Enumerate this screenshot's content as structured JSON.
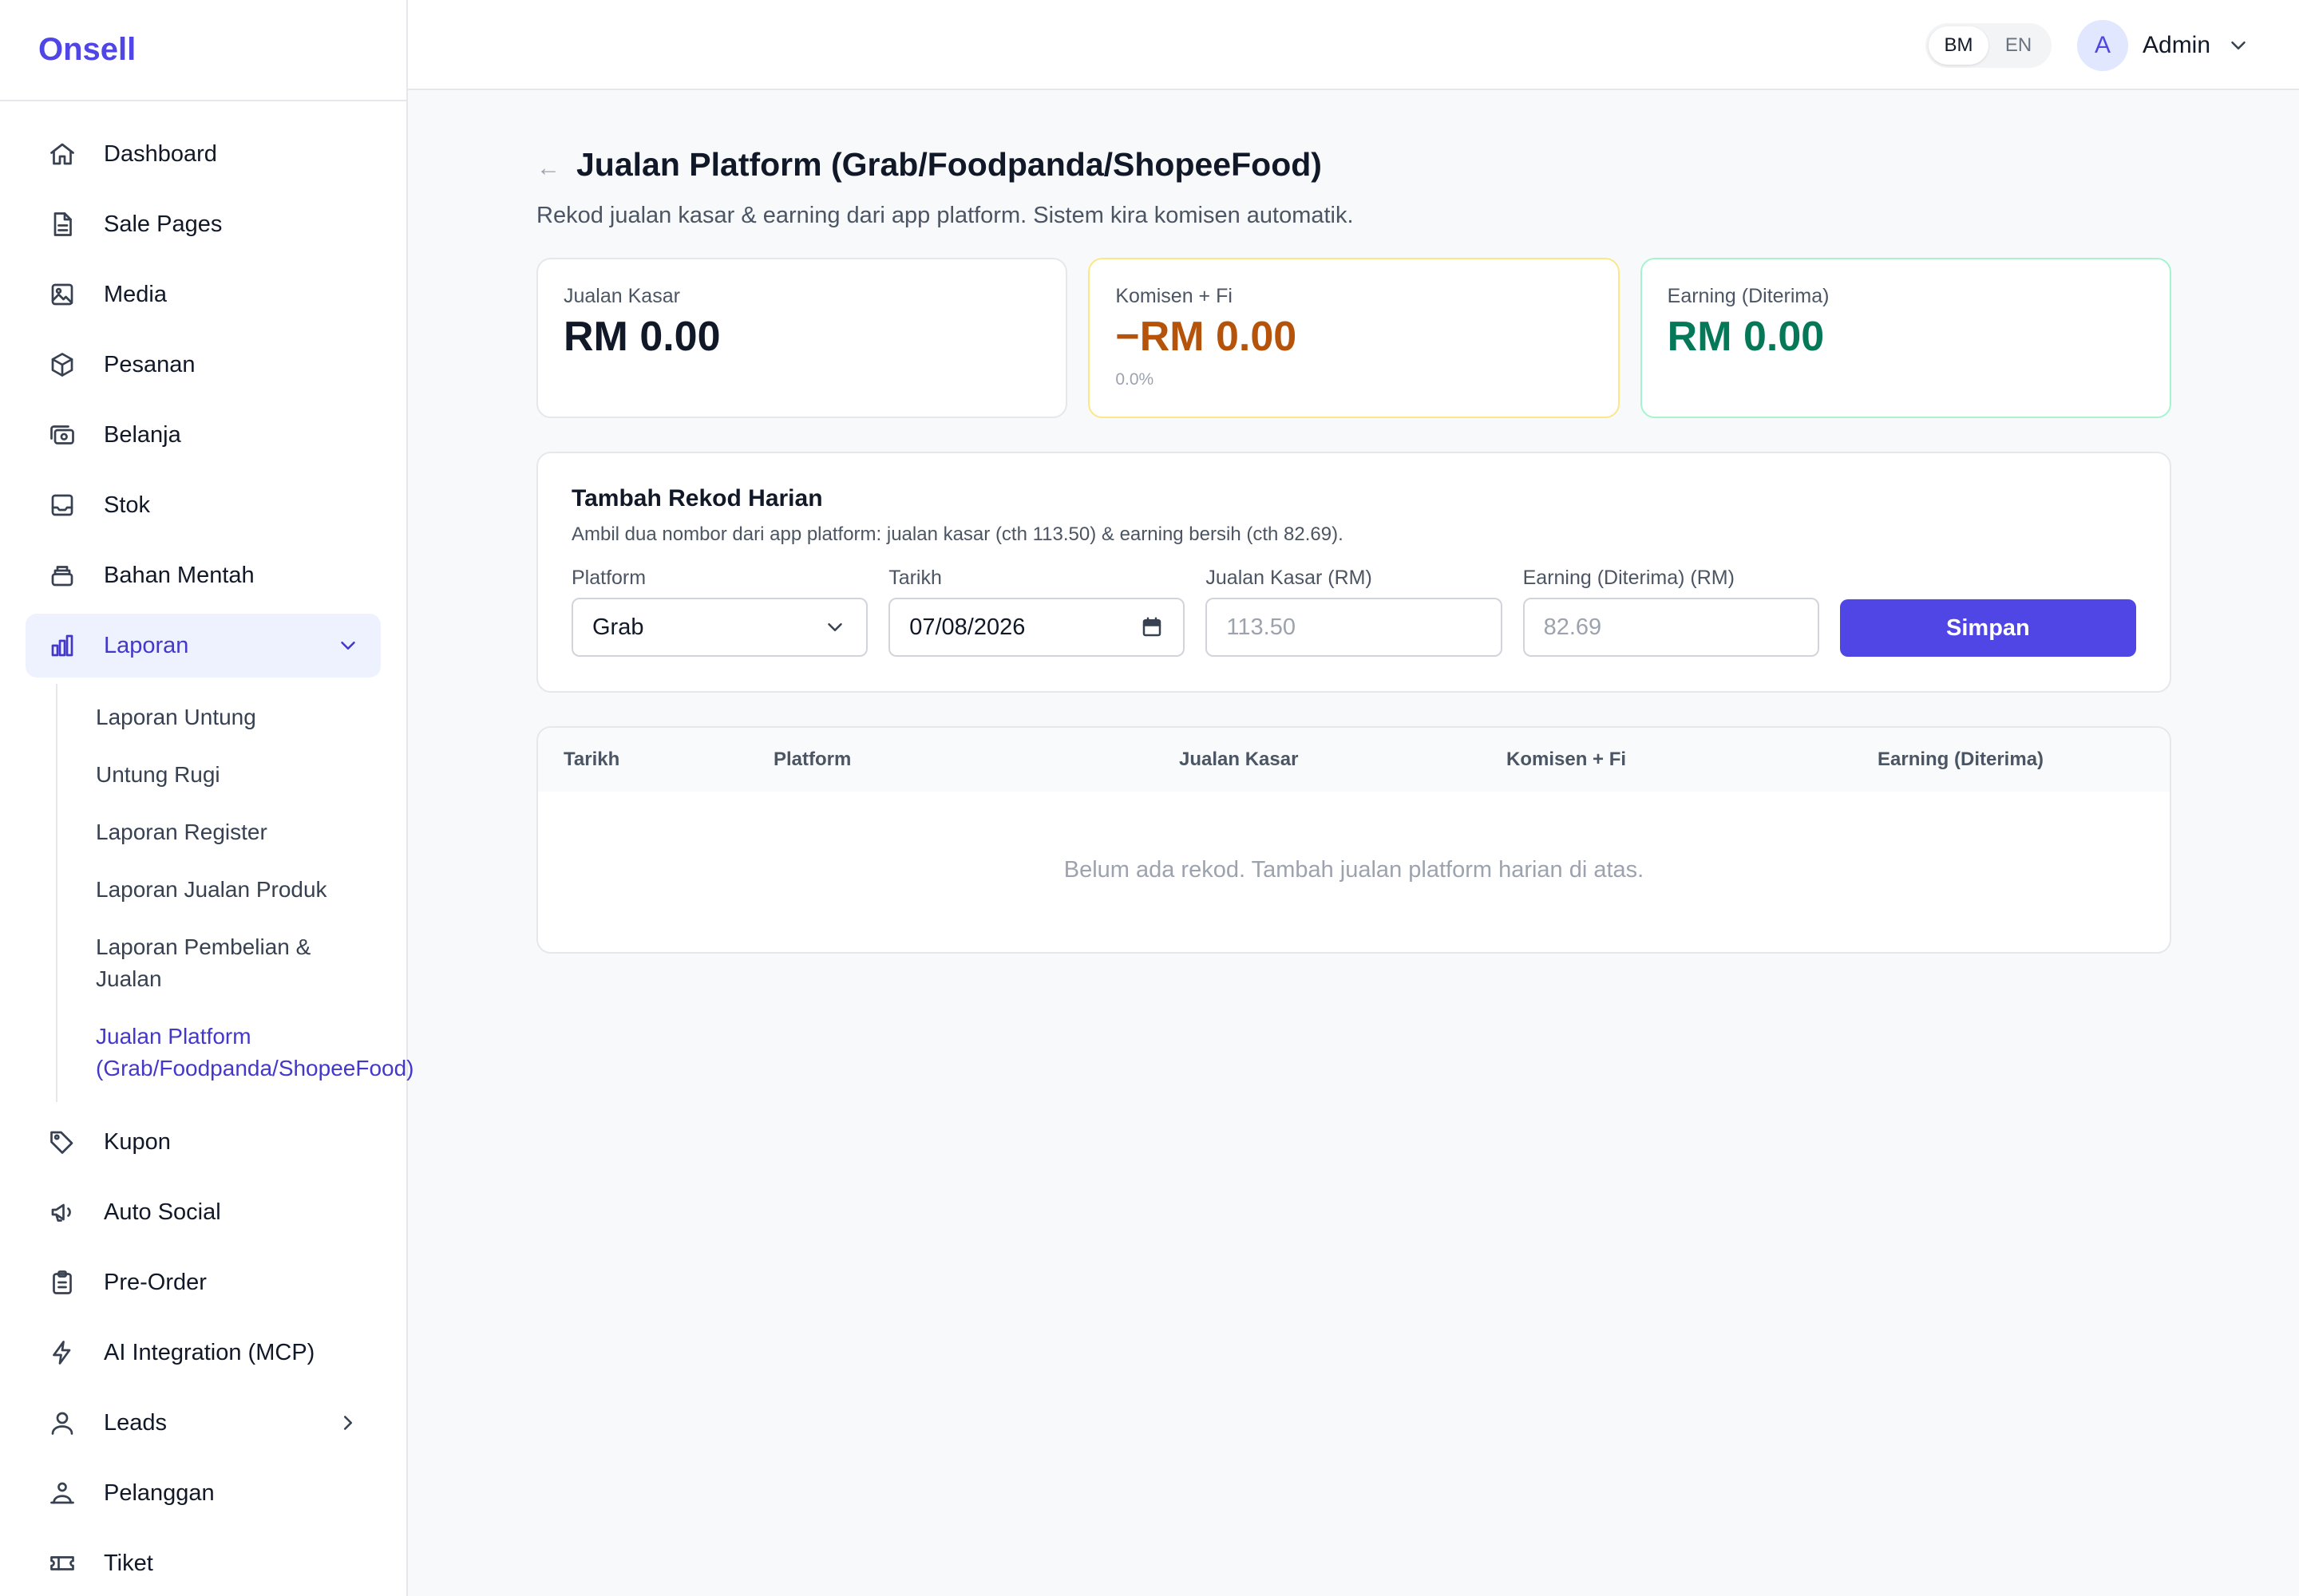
{
  "app": {
    "brand": "Onsell"
  },
  "sidebar": {
    "items": [
      {
        "label": "Dashboard",
        "icon": "home-icon"
      },
      {
        "label": "Sale Pages",
        "icon": "document-icon"
      },
      {
        "label": "Media",
        "icon": "image-icon"
      },
      {
        "label": "Pesanan",
        "icon": "box-icon"
      },
      {
        "label": "Belanja",
        "icon": "cash-icon"
      },
      {
        "label": "Stok",
        "icon": "inbox-icon"
      },
      {
        "label": "Bahan Mentah",
        "icon": "stack-icon"
      },
      {
        "label": "Laporan",
        "icon": "bar-chart-icon",
        "expanded": true,
        "active": true
      },
      {
        "label": "Kupon",
        "icon": "tag-icon"
      },
      {
        "label": "Auto Social",
        "icon": "megaphone-icon"
      },
      {
        "label": "Pre-Order",
        "icon": "clipboard-icon"
      },
      {
        "label": "AI Integration (MCP)",
        "icon": "bolt-icon"
      },
      {
        "label": "Leads",
        "icon": "user-icon",
        "has_children": true
      },
      {
        "label": "Pelanggan",
        "icon": "users-icon"
      },
      {
        "label": "Tiket",
        "icon": "ticket-icon"
      }
    ],
    "laporan_sub": [
      "Laporan Untung",
      "Untung Rugi",
      "Laporan Register",
      "Laporan Jualan Produk",
      "Laporan Pembelian & Jualan",
      "Jualan Platform (Grab/Foodpanda/ShopeeFood)"
    ]
  },
  "topbar": {
    "lang_options": [
      "BM",
      "EN"
    ],
    "lang_selected": "BM",
    "user_initial": "A",
    "user_name": "Admin"
  },
  "page": {
    "back_glyph": "←",
    "title": "Jualan Platform (Grab/Foodpanda/ShopeeFood)",
    "subtitle": "Rekod jualan kasar & earning dari app platform. Sistem kira komisen automatik."
  },
  "summary": {
    "gross": {
      "label": "Jualan Kasar",
      "value": "RM 0.00"
    },
    "commission": {
      "label": "Komisen + Fi",
      "value": "−RM 0.00",
      "note": "0.0%"
    },
    "earning": {
      "label": "Earning (Diterima)",
      "value": "RM 0.00"
    }
  },
  "form": {
    "title": "Tambah Rekod Harian",
    "desc": "Ambil dua nombor dari app platform: jualan kasar (cth 113.50) & earning bersih (cth 82.69).",
    "platform_label": "Platform",
    "platform_value": "Grab",
    "date_label": "Tarikh",
    "date_value": "07/08/2026",
    "gross_label": "Jualan Kasar (RM)",
    "gross_placeholder": "113.50",
    "earning_label": "Earning (Diterima) (RM)",
    "earning_placeholder": "82.69",
    "save_label": "Simpan"
  },
  "table": {
    "columns": [
      "Tarikh",
      "Platform",
      "Jualan Kasar",
      "Komisen + Fi",
      "Earning (Diterima)"
    ],
    "empty_text": "Belum ada rekod. Tambah jualan platform harian di atas."
  },
  "colors": {
    "accent": "#4f46e5",
    "commission": "#b45309",
    "earning": "#047857"
  }
}
